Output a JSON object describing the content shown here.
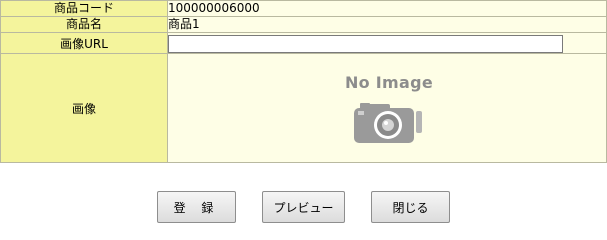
{
  "form": {
    "rows": [
      {
        "label": "商品コード",
        "value": "100000006000"
      },
      {
        "label": "商品名",
        "value": "商品1"
      },
      {
        "label": "画像URL",
        "value": ""
      },
      {
        "label": "画像",
        "value": ""
      }
    ],
    "image_placeholder_text": "No Image"
  },
  "buttons": {
    "register": "登 録",
    "preview": "プレビュー",
    "close": "閉じる"
  },
  "colors": {
    "label_bg": "#f4f49c",
    "value_bg": "#fefee6",
    "border": "#b9b9a0"
  }
}
